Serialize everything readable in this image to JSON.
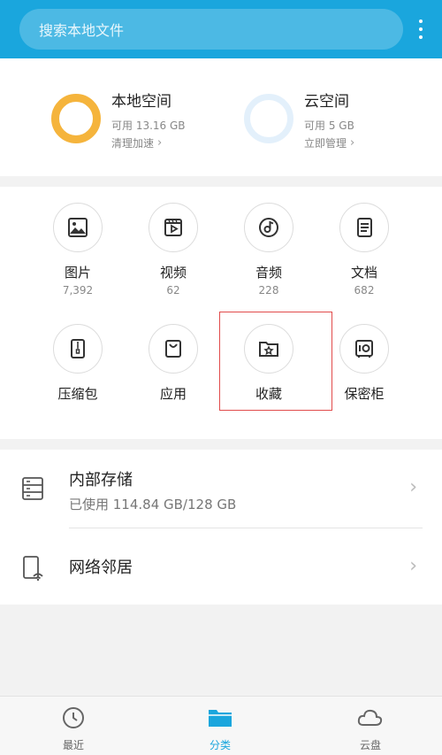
{
  "search": {
    "placeholder": "搜索本地文件"
  },
  "storage": {
    "local": {
      "title": "本地空间",
      "available": "可用 13.16 GB",
      "action": "清理加速"
    },
    "cloud": {
      "title": "云空间",
      "available": "可用 5 GB",
      "action": "立即管理"
    }
  },
  "categories": [
    {
      "label": "图片",
      "count": "7,392",
      "icon": "image-icon"
    },
    {
      "label": "视频",
      "count": "62",
      "icon": "video-icon"
    },
    {
      "label": "音频",
      "count": "228",
      "icon": "audio-icon"
    },
    {
      "label": "文档",
      "count": "682",
      "icon": "document-icon"
    },
    {
      "label": "压缩包",
      "icon": "zip-icon"
    },
    {
      "label": "应用",
      "icon": "app-bag-icon"
    },
    {
      "label": "收藏",
      "icon": "favorite-folder-icon"
    },
    {
      "label": "保密柜",
      "icon": "safe-icon"
    }
  ],
  "list": {
    "internal": {
      "title": "内部存储",
      "subtitle": "已使用 114.84 GB/128 GB"
    },
    "network": {
      "title": "网络邻居"
    }
  },
  "nav": {
    "recent": "最近",
    "category": "分类",
    "cloud": "云盘"
  },
  "colors": {
    "accent": "#1aa6dd",
    "local_ring": "#f5b43c",
    "highlight": "#e14b4b"
  }
}
